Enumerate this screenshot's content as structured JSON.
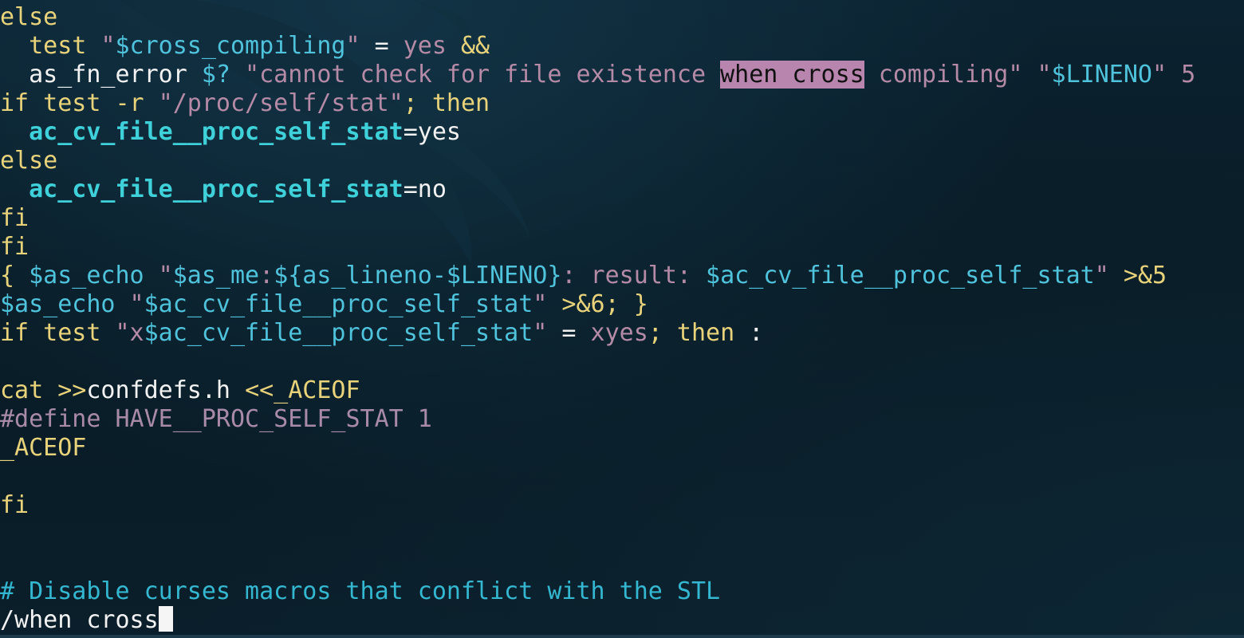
{
  "editor": {
    "search_query": "/when cross",
    "lines": [
      [
        {
          "t": "else",
          "c": "kw"
        }
      ],
      [
        {
          "t": "  test ",
          "c": "kw"
        },
        {
          "t": "\"",
          "c": "str"
        },
        {
          "t": "$cross_compiling",
          "c": "var"
        },
        {
          "t": "\"",
          "c": "str"
        },
        {
          "t": " = ",
          "c": "txt"
        },
        {
          "t": "yes",
          "c": "str"
        },
        {
          "t": " &&",
          "c": "kw"
        }
      ],
      [
        {
          "t": "  as_fn_error ",
          "c": "txt"
        },
        {
          "t": "$?",
          "c": "var"
        },
        {
          "t": " \"cannot check for file existence ",
          "c": "str"
        },
        {
          "t": "when cross",
          "c": "hl"
        },
        {
          "t": " compiling\"",
          "c": "str"
        },
        {
          "t": " \"",
          "c": "str"
        },
        {
          "t": "$LINENO",
          "c": "var"
        },
        {
          "t": "\"",
          "c": "str"
        },
        {
          "t": " 5",
          "c": "str"
        }
      ],
      [
        {
          "t": "if test -r ",
          "c": "kw"
        },
        {
          "t": "\"/proc/self/stat\"",
          "c": "str"
        },
        {
          "t": "; then",
          "c": "kw"
        }
      ],
      [
        {
          "t": "  ",
          "c": "txt"
        },
        {
          "t": "ac_cv_file__proc_self_stat",
          "c": "vb"
        },
        {
          "t": "=yes",
          "c": "txt"
        }
      ],
      [
        {
          "t": "else",
          "c": "kw"
        }
      ],
      [
        {
          "t": "  ",
          "c": "txt"
        },
        {
          "t": "ac_cv_file__proc_self_stat",
          "c": "vb"
        },
        {
          "t": "=no",
          "c": "txt"
        }
      ],
      [
        {
          "t": "fi",
          "c": "kw"
        }
      ],
      [
        {
          "t": "fi",
          "c": "kw"
        }
      ],
      [
        {
          "t": "{ ",
          "c": "kw"
        },
        {
          "t": "$as_echo",
          "c": "var"
        },
        {
          "t": " \"",
          "c": "str"
        },
        {
          "t": "$as_me",
          "c": "var"
        },
        {
          "t": ":",
          "c": "str"
        },
        {
          "t": "${as_lineno-$LINENO}",
          "c": "var"
        },
        {
          "t": ": result: ",
          "c": "str"
        },
        {
          "t": "$ac_cv_file__proc_self_stat",
          "c": "var"
        },
        {
          "t": "\"",
          "c": "str"
        },
        {
          "t": " >&5",
          "c": "kw"
        }
      ],
      [
        {
          "t": "$as_echo",
          "c": "var"
        },
        {
          "t": " \"",
          "c": "str"
        },
        {
          "t": "$ac_cv_file__proc_self_stat",
          "c": "var"
        },
        {
          "t": "\"",
          "c": "str"
        },
        {
          "t": " >&6; }",
          "c": "kw"
        }
      ],
      [
        {
          "t": "if test ",
          "c": "kw"
        },
        {
          "t": "\"x",
          "c": "str"
        },
        {
          "t": "$ac_cv_file__proc_self_stat",
          "c": "var"
        },
        {
          "t": "\"",
          "c": "str"
        },
        {
          "t": " = ",
          "c": "txt"
        },
        {
          "t": "xyes",
          "c": "str"
        },
        {
          "t": "; then",
          "c": "kw"
        },
        {
          "t": " :",
          "c": "txt"
        }
      ],
      [],
      [
        {
          "t": "cat ",
          "c": "kw"
        },
        {
          "t": ">>",
          "c": "kw"
        },
        {
          "t": "confdefs.h ",
          "c": "txt"
        },
        {
          "t": "<<_ACEOF",
          "c": "kw"
        }
      ],
      [
        {
          "t": "#define HAVE__PROC_SELF_STAT 1",
          "c": "pre"
        }
      ],
      [
        {
          "t": "_ACEOF",
          "c": "kw"
        }
      ],
      [],
      [
        {
          "t": "fi",
          "c": "kw"
        }
      ],
      [],
      [],
      [
        {
          "t": "# Disable curses macros that conflict with the STL",
          "c": "com"
        }
      ]
    ]
  },
  "colors": {
    "keyword": "#e8d27a",
    "string": "#b58aa6",
    "variable": "#4fc3dc",
    "variable_bold": "#3fd1d9",
    "text": "#f2f2f2",
    "preprocessor": "#a98aa9",
    "comment": "#34b7d0",
    "search_highlight": "#b785ad"
  }
}
